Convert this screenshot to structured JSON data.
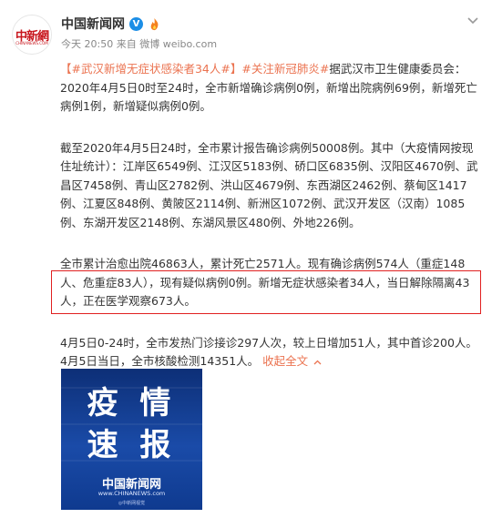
{
  "post": {
    "author": "中国新闻网",
    "verified_badge": "V",
    "time": "今天 20:50",
    "source_prefix": "来自",
    "source": "微博 weibo.com",
    "avatar_text": "中新網",
    "avatar_sub": "CHINANEWS.COM"
  },
  "content": {
    "tag1": "【#武汉新增无症状感染者34人#】",
    "tag2": "#关注新冠肺炎#",
    "p1_rest": "据武汉市卫生健康委员会：2020年4月5日0时至24时，全市新增确诊病例0例，新增出院病例69例，新增死亡病例1例，新增疑似病例0例。",
    "p2": "截至2020年4月5日24时，全市累计报告确诊病例50008例。其中（大疫情网按现住址统计）：江岸区6549例、江汉区5183例、硚口区6835例、汉阳区4670例、武昌区7458例、青山区2782例、洪山区4679例、东西湖区2462例、蔡甸区1417例、江夏区848例、黄陂区2114例、新洲区1072例、武汉开发区（汉南）1085例、东湖开发区2148例、东湖风景区480例、外地226例。",
    "p3_line1": "全市累计治愈出院46863人，累计死亡2571人。现有确诊病例574人（重症148",
    "p3_line2": "人、危重症83人），现有疑似病例0例。新增无症状感染者34人，当日解除隔离43",
    "p3_line3": "人，正在医学观察673人。",
    "p4": "4月5日0-24时，全市发热门诊接诊297人次，较上日增加51人，其中首诊200人。4月5日当日，全市核酸检测14351人。",
    "collapse_label": "收起全文"
  },
  "image_card": {
    "title_top": "疫 情",
    "title_bottom": "速 报",
    "brand": "中国新闻网",
    "site": "www.CHINANEWS.com",
    "footer": "◎中新网视觉"
  },
  "colors": {
    "accent": "#eb7350",
    "highlight_border": "#e02020",
    "badge_blue": "#1c8ee6",
    "card_blue": "#1a4ba8"
  }
}
